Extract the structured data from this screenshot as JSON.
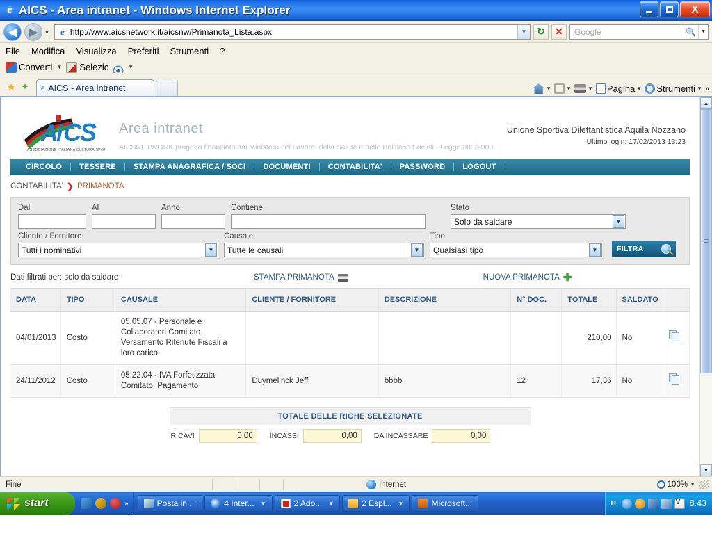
{
  "window": {
    "title": "AICS - Area intranet - Windows Internet Explorer",
    "minimize_label": "Minimize",
    "restore_label": "Restore",
    "close_label": "X"
  },
  "address_bar": {
    "url": "http://www.aicsnetwork.it/aicsnw/Primanota_Lista.aspx",
    "search_placeholder": "Google",
    "back_label": "◀",
    "forward_label": "▶"
  },
  "menu_bar": {
    "items": [
      "File",
      "Modifica",
      "Visualizza",
      "Preferiti",
      "Strumenti",
      "?"
    ]
  },
  "command_bar": {
    "convert_label": "Converti",
    "select_label": "Selezic"
  },
  "tab_bar": {
    "tab_title": "AICS - Area intranet",
    "right_items": [
      {
        "label": "",
        "icon": "home-icon"
      },
      {
        "label": "",
        "icon": "rss-icon"
      },
      {
        "label": "",
        "icon": "print-icon"
      },
      {
        "label": "Pagina",
        "icon": "page-icon"
      },
      {
        "label": "Strumenti",
        "icon": "gear-icon"
      }
    ],
    "overflow": "»"
  },
  "site": {
    "logo_text": "AICS",
    "logo_sub": "ASSOCIAZIONE ITALIANA CULTURA SPORT",
    "title": "Area intranet",
    "subtitle": "AICSNETWORK progetto finanziato dal Ministero del Lavoro, della Salute e delle Politiche Sociali - Legge 383/2000",
    "org_name": "Unione Sportiva Dilettantistica Aquila Nozzano",
    "last_login": "Ultimo login: 17/02/2013 13:23"
  },
  "nav": {
    "items": [
      "CIRCOLO",
      "TESSERE",
      "STAMPA ANAGRAFICA / SOCI",
      "DOCUMENTI",
      "CONTABILITA'",
      "PASSWORD",
      "LOGOUT"
    ]
  },
  "breadcrumb": {
    "root": "CONTABILITA'",
    "separator": "❯",
    "current": "PRIMANOTA"
  },
  "filters": {
    "dal_label": "Dal",
    "dal_value": "",
    "al_label": "Al",
    "al_value": "",
    "anno_label": "Anno",
    "anno_value": "",
    "contiene_label": "Contiene",
    "contiene_value": "",
    "stato_label": "Stato",
    "stato_value": "Solo da saldare",
    "cliente_label": "Cliente / Fornitore",
    "cliente_value": "Tutti i nominativi",
    "causale_label": "Causale",
    "causale_value": "Tutte le causali",
    "tipo_label": "Tipo",
    "tipo_value": "Qualsiasi tipo",
    "filtra_label": "FILTRA"
  },
  "actions": {
    "filtered_note": "Dati filtrati per: solo da saldare",
    "print_label": "STAMPA PRIMANOTA",
    "new_label": "NUOVA PRIMANOTA"
  },
  "table": {
    "headers": [
      "DATA",
      "TIPO",
      "CAUSALE",
      "CLIENTE / FORNITORE",
      "DESCRIZIONE",
      "N° DOC.",
      "TOTALE",
      "SALDATO",
      ""
    ],
    "rows": [
      {
        "data": "04/01/2013",
        "tipo": "Costo",
        "causale": "05.05.07 - Personale e Collaboratori Comitato. Versamento Ritenute Fiscali a loro carico",
        "cliente": "",
        "descrizione": "",
        "ndoc": "",
        "totale": "210,00",
        "saldato": "No",
        "action_icon": "copy-icon"
      },
      {
        "data": "24/11/2012",
        "tipo": "Costo",
        "causale": "05.22.04 - IVA Forfetizzata Comitato. Pagamento",
        "cliente": "Duymelinck Jeff",
        "descrizione": "bbbb",
        "ndoc": "12",
        "totale": "17,36",
        "saldato": "No",
        "action_icon": "copy-icon"
      }
    ]
  },
  "totals": {
    "header": "TOTALE DELLE RIGHE SELEZIONATE",
    "ricavi_label": "RICAVI",
    "ricavi_value": "0,00",
    "incassi_label": "INCASSI",
    "incassi_value": "0,00",
    "da_incassare_label": "DA INCASSARE",
    "da_incassare_value": "0,00"
  },
  "status_bar": {
    "status": "Fine",
    "zone": "Internet",
    "zoom": "100%"
  },
  "taskbar": {
    "start_label": "start",
    "quicklaunch_overflow": "»",
    "tasks": [
      {
        "label": "Posta in ...",
        "icon": "mail-icon",
        "has_caret": false
      },
      {
        "label": "4 Inter...",
        "icon": "ie-icon",
        "has_caret": true
      },
      {
        "label": "2 Ado...",
        "icon": "pdf-icon",
        "has_caret": true
      },
      {
        "label": "2 Espl...",
        "icon": "folder-icon",
        "has_caret": true
      },
      {
        "label": "Microsoft...",
        "icon": "powerpoint-icon",
        "has_caret": false
      }
    ],
    "tray_lang": "IT",
    "clock": "8.43"
  }
}
